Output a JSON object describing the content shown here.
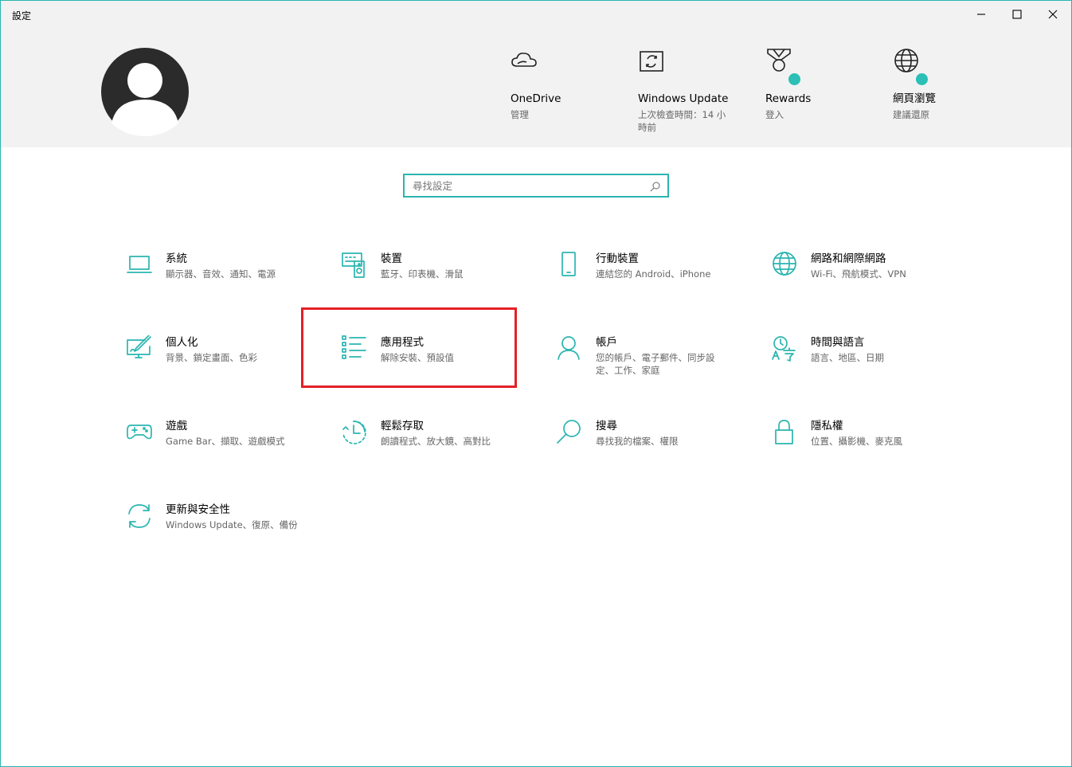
{
  "window": {
    "title": "設定"
  },
  "colors": {
    "accent": "#2bb5b0",
    "highlight": "#e32026",
    "header_bg": "#f2f2f2"
  },
  "quick_links": [
    {
      "title": "OneDrive",
      "subtitle": "管理",
      "icon": "cloud-icon"
    },
    {
      "title": "Windows Update",
      "subtitle": "上次檢查時間：14 小時前",
      "icon": "windows-update-icon"
    },
    {
      "title": "Rewards",
      "subtitle": "登入",
      "icon": "rewards-medal-icon"
    },
    {
      "title": "網頁瀏覽",
      "subtitle": "建議還原",
      "icon": "globe-icon"
    }
  ],
  "search": {
    "placeholder": "尋找設定"
  },
  "categories": [
    {
      "title": "系統",
      "subtitle": "顯示器、音效、通知、電源",
      "icon": "laptop-icon"
    },
    {
      "title": "裝置",
      "subtitle": "藍牙、印表機、滑鼠",
      "icon": "keyboard-speaker-icon"
    },
    {
      "title": "行動裝置",
      "subtitle": "連結您的 Android、iPhone",
      "icon": "phone-icon"
    },
    {
      "title": "網路和網際網路",
      "subtitle": "Wi-Fi、飛航模式、VPN",
      "icon": "globe-icon"
    },
    {
      "title": "個人化",
      "subtitle": "背景、鎖定畫面、色彩",
      "icon": "paint-brush-icon"
    },
    {
      "title": "應用程式",
      "subtitle": "解除安裝、預設值",
      "icon": "apps-list-icon"
    },
    {
      "title": "帳戶",
      "subtitle": "您的帳戶、電子郵件、同步設定、工作、家庭",
      "icon": "person-icon"
    },
    {
      "title": "時間與語言",
      "subtitle": "語言、地區、日期",
      "icon": "time-language-icon"
    },
    {
      "title": "遊戲",
      "subtitle": "Game Bar、擷取、遊戲模式",
      "icon": "gamepad-icon"
    },
    {
      "title": "輕鬆存取",
      "subtitle": "朗讀程式、放大鏡、高對比",
      "icon": "ease-of-access-icon"
    },
    {
      "title": "搜尋",
      "subtitle": "尋找我的檔案、權限",
      "icon": "search-icon"
    },
    {
      "title": "隱私權",
      "subtitle": "位置、攝影機、麥克風",
      "icon": "lock-icon"
    },
    {
      "title": "更新與安全性",
      "subtitle": "Windows Update、復原、備份",
      "icon": "sync-icon"
    }
  ]
}
